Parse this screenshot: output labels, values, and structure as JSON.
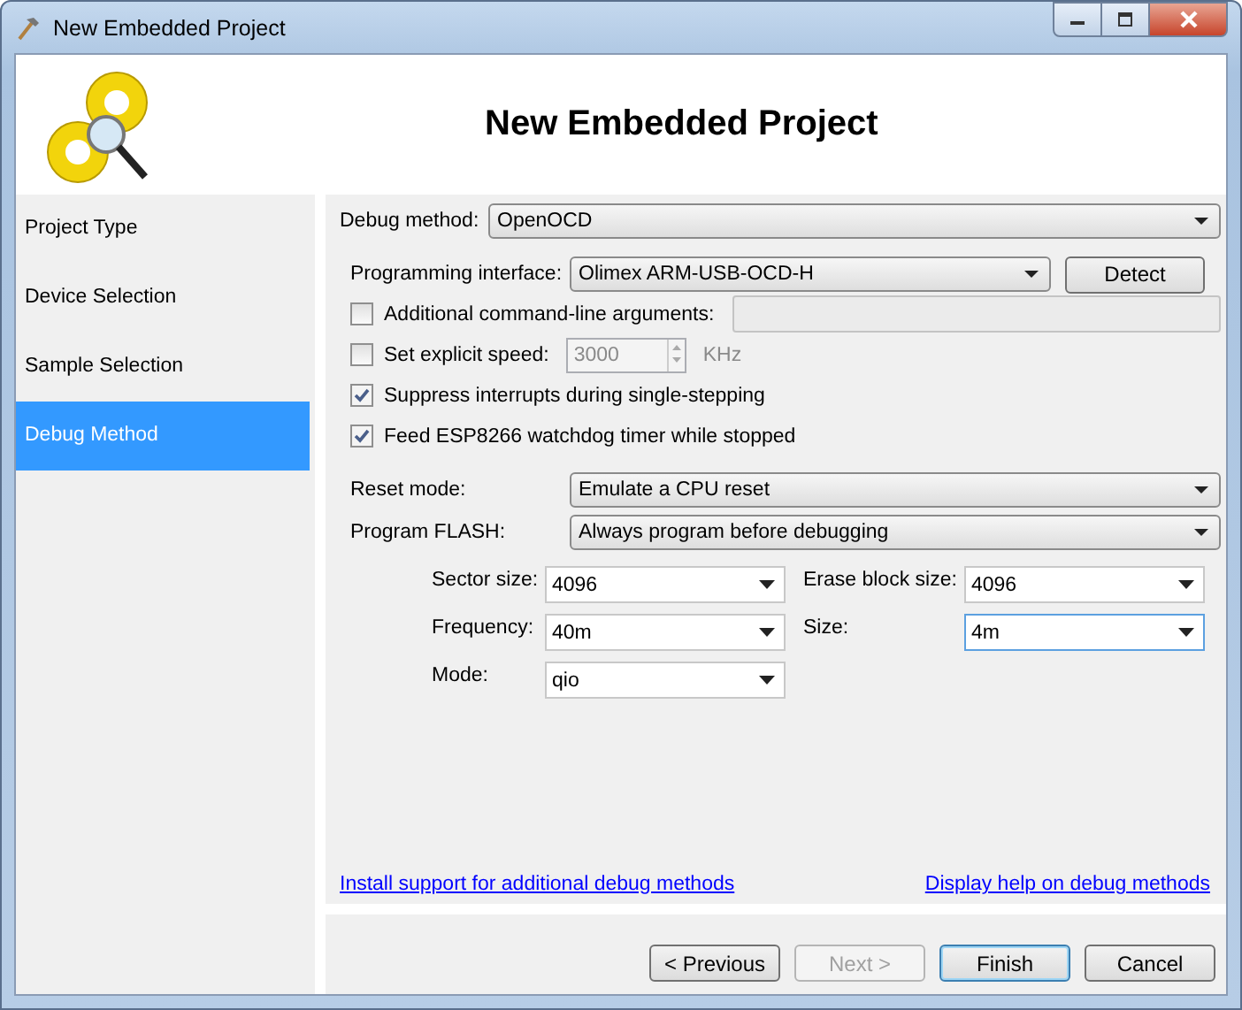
{
  "window": {
    "title": "New Embedded Project"
  },
  "header": {
    "title": "New Embedded Project"
  },
  "sidebar": {
    "items": [
      {
        "label": "Project Type",
        "selected": false
      },
      {
        "label": "Device Selection",
        "selected": false
      },
      {
        "label": "Sample Selection",
        "selected": false
      },
      {
        "label": "Debug Method",
        "selected": true
      }
    ]
  },
  "debug_method": {
    "label": "Debug method:",
    "value": "OpenOCD"
  },
  "programming_interface": {
    "label": "Programming interface:",
    "value": "Olimex ARM-USB-OCD-H",
    "button": "Detect"
  },
  "options": [
    {
      "kind": "text",
      "label": "Additional command-line arguments:",
      "checked": false,
      "disabled": true
    },
    {
      "kind": "speed",
      "label": "Set explicit speed:",
      "checked": false,
      "disabled": true,
      "value": "3000",
      "unit": "KHz"
    },
    {
      "kind": "plain",
      "label": "Suppress interrupts during single-stepping",
      "checked": true
    },
    {
      "kind": "plain",
      "label": "Feed ESP8266 watchdog timer while stopped",
      "checked": true
    }
  ],
  "reset_mode": {
    "label": "Reset mode:",
    "value": "Emulate a CPU reset"
  },
  "program_flash": {
    "label": "Program FLASH:",
    "value": "Always program before debugging"
  },
  "flash_settings": [
    {
      "label": "Sector size:",
      "value": "4096",
      "focused": false
    },
    {
      "label": "Erase block size:",
      "value": "4096",
      "focused": false
    },
    {
      "label": "Frequency:",
      "value": "40m",
      "focused": false
    },
    {
      "label": "Size:",
      "value": "4m",
      "focused": true
    },
    {
      "label": "Mode:",
      "value": "qio",
      "focused": false
    }
  ],
  "links": [
    "Install support for additional debug methods",
    "Display help on debug methods"
  ],
  "buttons": [
    {
      "label": "< Previous",
      "disabled": false,
      "default": false
    },
    {
      "label": "Next >",
      "disabled": true,
      "default": false
    },
    {
      "label": "Finish",
      "disabled": false,
      "default": true
    },
    {
      "label": "Cancel",
      "disabled": false,
      "default": false
    }
  ]
}
